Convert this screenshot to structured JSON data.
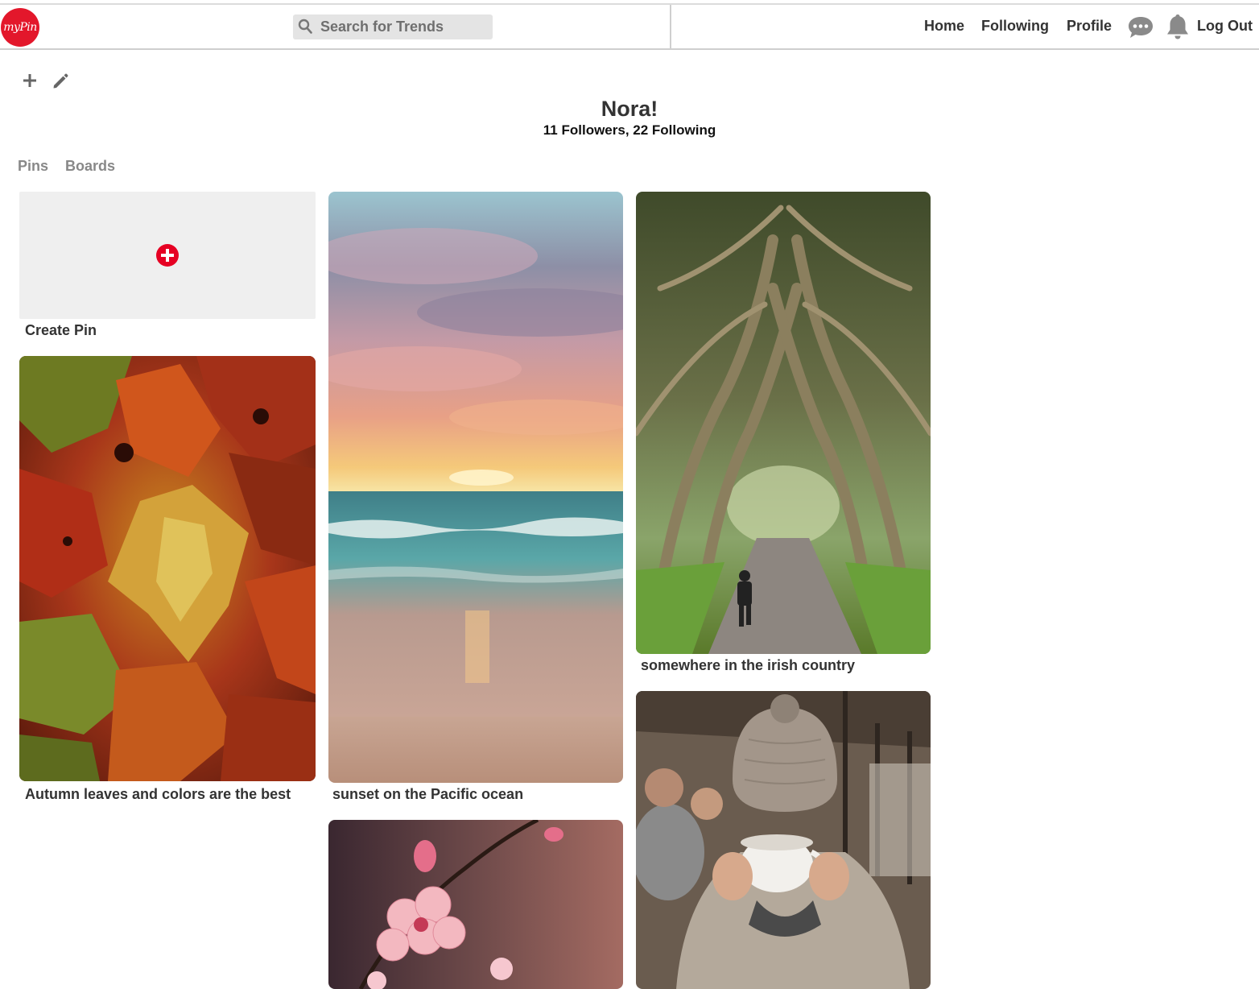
{
  "app": {
    "logo_text": "myPin",
    "brand_color": "#e3172b"
  },
  "search": {
    "placeholder": "Search for Trends",
    "value": ""
  },
  "nav": {
    "home": "Home",
    "following": "Following",
    "profile": "Profile",
    "logout": "Log Out"
  },
  "profile": {
    "name": "Nora!",
    "stats": "11 Followers, 22 Following"
  },
  "tabs": [
    "Pins",
    "Boards"
  ],
  "create_pin": {
    "label": "Create Pin"
  },
  "pins": [
    {
      "caption": "Autumn leaves and colors are the best",
      "image": "autumn-leaves"
    },
    {
      "caption": "sunset on the Pacific ocean",
      "image": "ocean-sunset"
    },
    {
      "caption": "somewhere in the irish country",
      "image": "tree-tunnel-road"
    },
    {
      "caption": "",
      "image": "cherry-blossoms"
    },
    {
      "caption": "",
      "image": "woman-with-coffee-cup"
    }
  ]
}
